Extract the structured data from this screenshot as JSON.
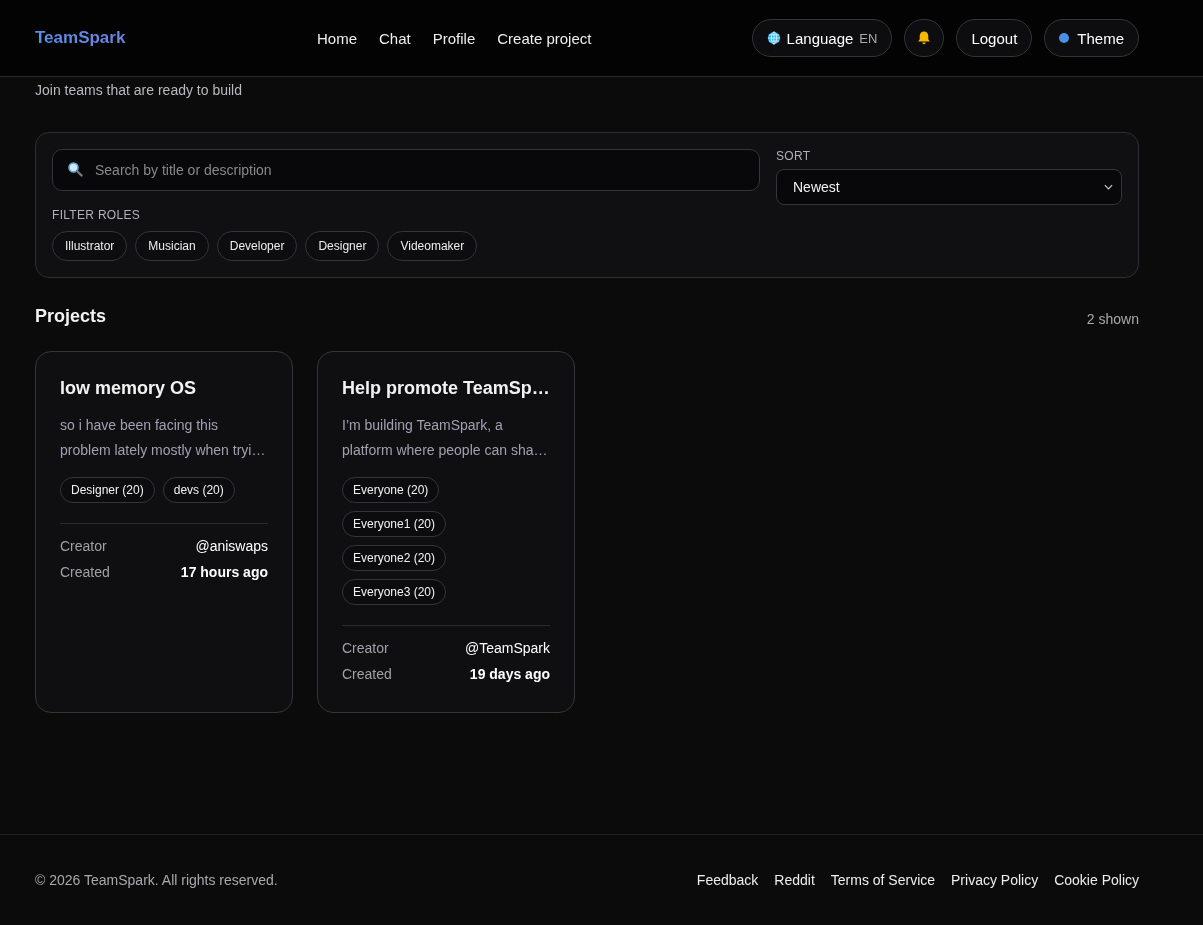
{
  "brand": "TeamSpark",
  "nav": [
    "Home",
    "Chat",
    "Profile",
    "Create project"
  ],
  "actions": {
    "language": {
      "label": "Language",
      "code": "EN"
    },
    "logout": "Logout",
    "theme": "Theme"
  },
  "subtitle": "Join teams that are ready to build",
  "filters": {
    "search_placeholder": "Search by title or description",
    "sort_label": "SORT",
    "sort_value": "Newest",
    "roles_label": "FILTER ROLES",
    "roles": [
      "Illustrator",
      "Musician",
      "Developer",
      "Designer",
      "Videomaker"
    ]
  },
  "projects": {
    "heading": "Projects",
    "count": "2 shown",
    "cards": [
      {
        "title": "low memory OS",
        "description": [
          "so i have been facing this",
          "problem lately mostly when tryi…"
        ],
        "tags": [
          "Designer (20)",
          "devs (20)"
        ],
        "creator_label": "Creator",
        "creator": "@aniswaps",
        "created_label": "Created",
        "created": "17 hours ago"
      },
      {
        "title": "Help promote TeamSp…",
        "description": [
          "I’m building TeamSpark, a",
          "platform where people can sha…"
        ],
        "tags": [
          "Everyone (20)",
          "Everyone1 (20)",
          "Everyone2 (20)",
          "Everyone3 (20)"
        ],
        "creator_label": "Creator",
        "creator": "@TeamSpark",
        "created_label": "Created",
        "created": "19 days ago"
      }
    ]
  },
  "footer": {
    "copyright": "© 2026 TeamSpark. All rights reserved.",
    "links": [
      "Feedback",
      "Reddit",
      "Terms of Service",
      "Privacy Policy",
      "Cookie Policy"
    ]
  }
}
